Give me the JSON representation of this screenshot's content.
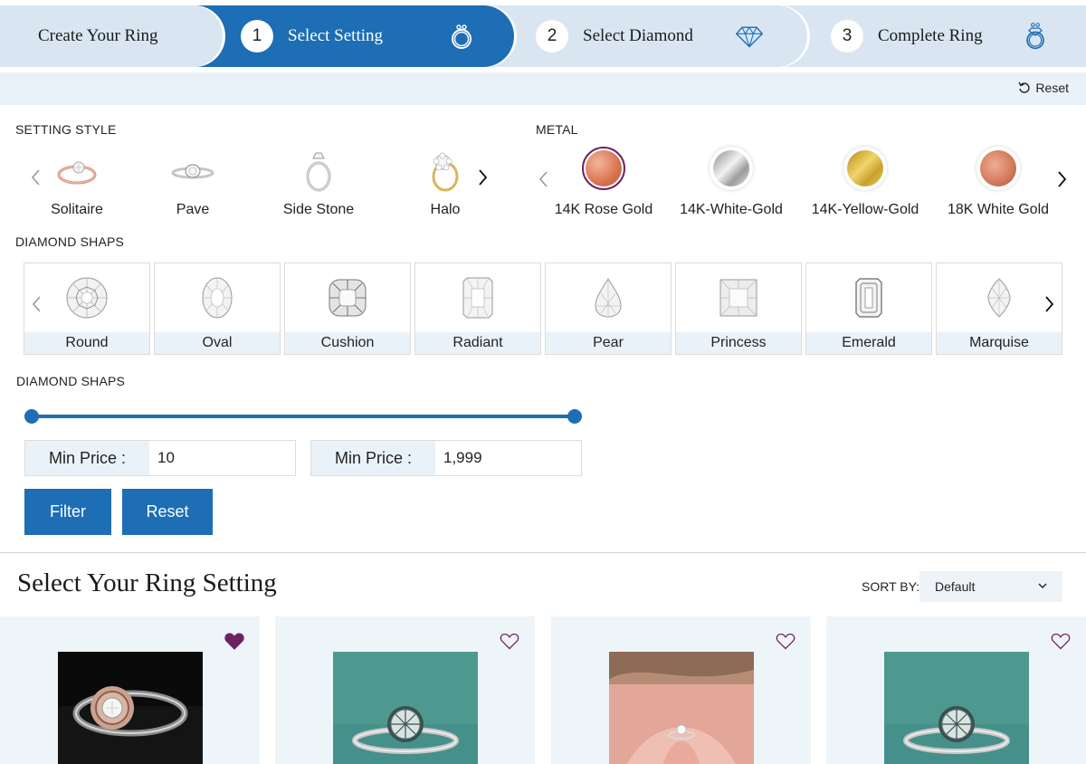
{
  "stepper": {
    "create_label": "Create Your Ring",
    "steps": [
      {
        "num": "1",
        "label": "Select Setting",
        "icon": "ring-icon"
      },
      {
        "num": "2",
        "label": "Select Diamond",
        "icon": "diamond-icon"
      },
      {
        "num": "3",
        "label": "Complete Ring",
        "icon": "complete-ring-icon"
      }
    ],
    "active_step": 1
  },
  "reset_bar": {
    "label": "Reset"
  },
  "setting_style": {
    "title": "SETTING STYLE",
    "items": [
      {
        "label": "Solitaire"
      },
      {
        "label": "Pave"
      },
      {
        "label": "Side Stone"
      },
      {
        "label": "Halo"
      }
    ]
  },
  "metal": {
    "title": "METAL",
    "items": [
      {
        "label": "14K Rose Gold",
        "color": "#d9734f",
        "active": true
      },
      {
        "label": "14K-White-Gold",
        "color": "#c7c7c7"
      },
      {
        "label": "14K-Yellow-Gold",
        "color": "#d4ad2c"
      },
      {
        "label": "18K White Gold",
        "color": "#d3785a"
      }
    ]
  },
  "diamond_shapes": {
    "title": "DIAMOND SHAPS",
    "items": [
      {
        "label": "Round"
      },
      {
        "label": "Oval"
      },
      {
        "label": "Cushion"
      },
      {
        "label": "Radiant"
      },
      {
        "label": "Pear"
      },
      {
        "label": "Princess"
      },
      {
        "label": "Emerald"
      },
      {
        "label": "Marquise"
      }
    ]
  },
  "price": {
    "title": "DIAMOND SHAPS",
    "min_label": "Min Price :",
    "min_value": "10",
    "max_label": "Min Price :",
    "max_value": "1,999",
    "filter_label": "Filter",
    "reset_label": "Reset"
  },
  "results": {
    "title": "Select Your Ring Setting",
    "sort_label": "SORT BY:",
    "sort_value": "Default",
    "cards": [
      {
        "favorited": true
      },
      {
        "favorited": false
      },
      {
        "favorited": false
      },
      {
        "favorited": false
      }
    ]
  },
  "colors": {
    "brand_blue": "#1d6eb5",
    "light_blue": "#d9e6f2",
    "accent_purple": "#6b2463"
  }
}
